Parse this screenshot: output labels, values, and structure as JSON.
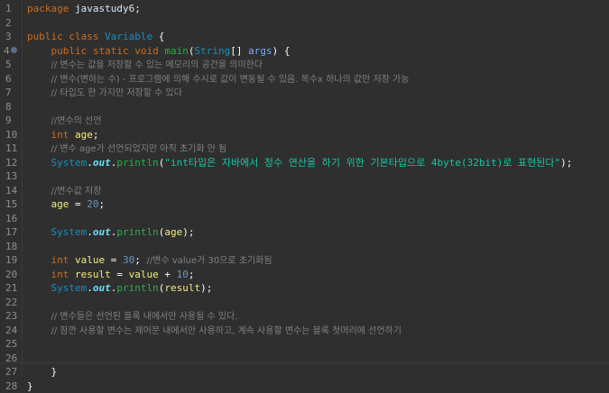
{
  "editor": {
    "language": "java",
    "lines": [
      {
        "n": "1",
        "segs": [
          [
            "kw",
            "package"
          ],
          [
            "pk",
            " javastudy6;"
          ]
        ]
      },
      {
        "n": "2",
        "segs": []
      },
      {
        "n": "3",
        "segs": [
          [
            "kw",
            "public"
          ],
          [
            "p",
            " "
          ],
          [
            "kw",
            "class"
          ],
          [
            "p",
            " "
          ],
          [
            "ty",
            "Variable"
          ],
          [
            "p",
            " {"
          ]
        ]
      },
      {
        "n": "4",
        "override": true,
        "segs": [
          [
            "p",
            "    "
          ],
          [
            "kw",
            "public"
          ],
          [
            "p",
            " "
          ],
          [
            "kw",
            "static"
          ],
          [
            "p",
            " "
          ],
          [
            "kw",
            "void"
          ],
          [
            "p",
            " "
          ],
          [
            "mth",
            "main"
          ],
          [
            "p",
            "("
          ],
          [
            "ty",
            "String"
          ],
          [
            "p",
            "[] "
          ],
          [
            "par",
            "args"
          ],
          [
            "p",
            ") {"
          ]
        ]
      },
      {
        "n": "5",
        "segs": [
          [
            "p",
            "    "
          ],
          [
            "cm",
            "// 변수는 값을 저장할 수 있는 메모리의 공간을 의미한다"
          ]
        ]
      },
      {
        "n": "6",
        "segs": [
          [
            "p",
            "    "
          ],
          [
            "cm",
            "// 변수(변하는 수) - 프로그램에 의해 수시로 값이 변동될 수 있음. 복수x 하나의 값만 저장 가능"
          ]
        ]
      },
      {
        "n": "7",
        "segs": [
          [
            "p",
            "    "
          ],
          [
            "cm",
            "// 타입도 한 가지만 저장할 수 있다"
          ]
        ]
      },
      {
        "n": "8",
        "segs": []
      },
      {
        "n": "9",
        "segs": [
          [
            "p",
            "    "
          ],
          [
            "cm",
            "//변수의 선언"
          ]
        ]
      },
      {
        "n": "10",
        "segs": [
          [
            "p",
            "    "
          ],
          [
            "kw",
            "int"
          ],
          [
            "p",
            " "
          ],
          [
            "var",
            "age"
          ],
          [
            "p",
            ";"
          ]
        ]
      },
      {
        "n": "11",
        "segs": [
          [
            "p",
            "    "
          ],
          [
            "cm",
            "// 변수 age가 선언되었지만 아직 초기화 안 됨"
          ]
        ]
      },
      {
        "n": "12",
        "segs": [
          [
            "p",
            "    "
          ],
          [
            "ty",
            "System"
          ],
          [
            "p",
            "."
          ],
          [
            "fld",
            "out"
          ],
          [
            "p",
            "."
          ],
          [
            "mth",
            "println"
          ],
          [
            "p",
            "("
          ],
          [
            "st",
            "\"int타입은 자바에서 정수 연산을 하기 위한 기본타입으로 4byte(32bit)로 표현된다\""
          ],
          [
            "p",
            ");"
          ]
        ]
      },
      {
        "n": "13",
        "segs": []
      },
      {
        "n": "14",
        "segs": [
          [
            "p",
            "    "
          ],
          [
            "cm",
            "//변수값 저장"
          ]
        ]
      },
      {
        "n": "15",
        "segs": [
          [
            "p",
            "    "
          ],
          [
            "var",
            "age"
          ],
          [
            "p",
            " = "
          ],
          [
            "nm",
            "20"
          ],
          [
            "p",
            ";"
          ]
        ]
      },
      {
        "n": "16",
        "segs": []
      },
      {
        "n": "17",
        "segs": [
          [
            "p",
            "    "
          ],
          [
            "ty",
            "System"
          ],
          [
            "p",
            "."
          ],
          [
            "fld",
            "out"
          ],
          [
            "p",
            "."
          ],
          [
            "mth",
            "println"
          ],
          [
            "p",
            "("
          ],
          [
            "var",
            "age"
          ],
          [
            "p",
            ");"
          ]
        ]
      },
      {
        "n": "18",
        "segs": []
      },
      {
        "n": "19",
        "segs": [
          [
            "p",
            "    "
          ],
          [
            "kw",
            "int"
          ],
          [
            "p",
            " "
          ],
          [
            "var",
            "value"
          ],
          [
            "p",
            " = "
          ],
          [
            "nm",
            "30"
          ],
          [
            "p",
            "; "
          ],
          [
            "cm",
            "//변수 value가 30으로 초기화됨"
          ]
        ]
      },
      {
        "n": "20",
        "segs": [
          [
            "p",
            "    "
          ],
          [
            "kw",
            "int"
          ],
          [
            "p",
            " "
          ],
          [
            "var",
            "result"
          ],
          [
            "p",
            " = "
          ],
          [
            "var",
            "value"
          ],
          [
            "p",
            " + "
          ],
          [
            "nm",
            "10"
          ],
          [
            "p",
            ";"
          ]
        ]
      },
      {
        "n": "21",
        "segs": [
          [
            "p",
            "    "
          ],
          [
            "ty",
            "System"
          ],
          [
            "p",
            "."
          ],
          [
            "fld",
            "out"
          ],
          [
            "p",
            "."
          ],
          [
            "mth",
            "println"
          ],
          [
            "p",
            "("
          ],
          [
            "var",
            "result"
          ],
          [
            "p",
            ");"
          ]
        ]
      },
      {
        "n": "22",
        "segs": []
      },
      {
        "n": "23",
        "segs": [
          [
            "p",
            "    "
          ],
          [
            "cm",
            "// 변수들은 선언된 블록 내에서만 사용될 수 있다."
          ]
        ]
      },
      {
        "n": "24",
        "segs": [
          [
            "p",
            "    "
          ],
          [
            "cm",
            "// 잠깐 사용할 변수는 제어문 내에서만 사용하고, 계속 사용할 변수는 블록 첫머리에 선언하기"
          ]
        ]
      },
      {
        "n": "25",
        "segs": []
      },
      {
        "n": "26",
        "segs": []
      },
      {
        "n": "27",
        "segs": [
          [
            "p",
            "    }"
          ]
        ]
      },
      {
        "n": "28",
        "segs": [
          [
            "p",
            "}"
          ]
        ]
      }
    ]
  },
  "colors": {
    "background": "#2f2f2f",
    "keyword": "#cc6c1d",
    "type": "#1290c3",
    "comment": "#808080",
    "string": "#17c6a3",
    "number": "#6897bb",
    "method": "#1eb540",
    "field": "#66e1f8",
    "line_number": "#8f8f8f"
  },
  "icons": {
    "override_marker": "override-triangle-icon"
  }
}
